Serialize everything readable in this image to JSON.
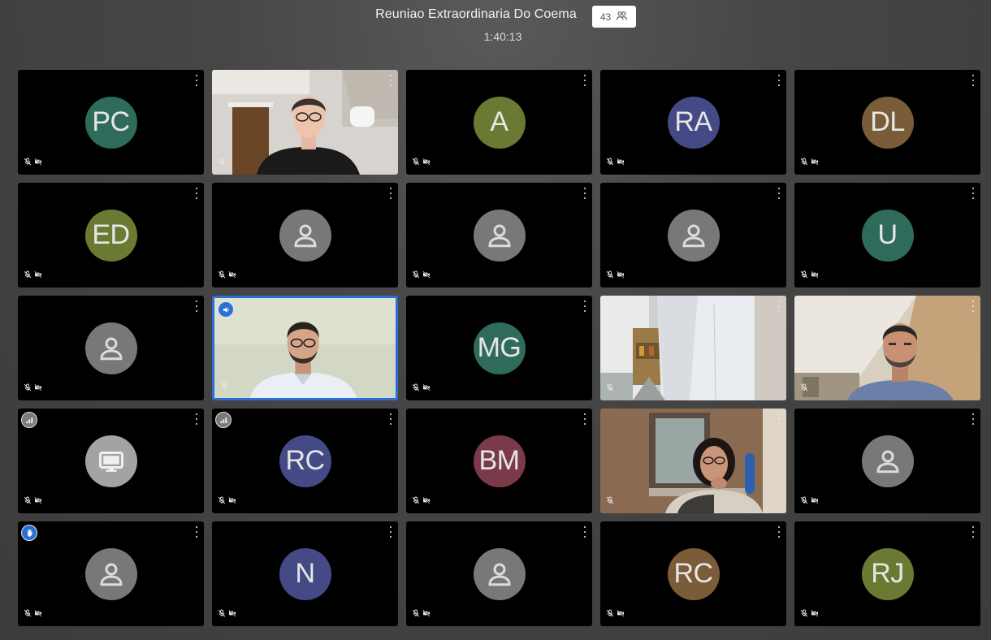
{
  "meeting": {
    "title": "Reuniao Extraordinaria Do Coema",
    "elapsed": "1:40:13",
    "participant_count": "43",
    "count_icon": "participants-icon"
  },
  "tiles": [
    {
      "initials": "PC",
      "color": "#2f6b5a"
    },
    {
      "video": "woman-glasses-room"
    },
    {
      "initials": "A",
      "color": "#6b7a32"
    },
    {
      "initials": "RA",
      "color": "#434a86"
    },
    {
      "initials": "DL",
      "color": "#7a5c38"
    },
    {
      "initials": "ED",
      "color": "#6b7a32"
    },
    {
      "icon": "person-icon"
    },
    {
      "icon": "person-icon"
    },
    {
      "icon": "person-icon"
    },
    {
      "initials": "U",
      "color": "#2f6b5a"
    },
    {
      "icon": "person-icon"
    },
    {
      "video": "man-glasses-speaking",
      "speaking": true,
      "badge": "speaker-icon"
    },
    {
      "initials": "MG",
      "color": "#2f6b5a"
    },
    {
      "video": "person-white-shirt"
    },
    {
      "video": "man-beard-room"
    },
    {
      "icon": "screen-share-icon",
      "badge": "signal-icon"
    },
    {
      "initials": "RC",
      "color": "#434a86",
      "badge": "signal-icon"
    },
    {
      "initials": "BM",
      "color": "#7a3a4a"
    },
    {
      "video": "woman-glasses-chin"
    },
    {
      "icon": "person-icon"
    },
    {
      "icon": "person-icon",
      "badge": "raised-hand-icon"
    },
    {
      "initials": "N",
      "color": "#434a86"
    },
    {
      "icon": "person-icon"
    },
    {
      "initials": "RC",
      "color": "#7a5c38"
    },
    {
      "initials": "RJ",
      "color": "#6b7a32"
    }
  ]
}
